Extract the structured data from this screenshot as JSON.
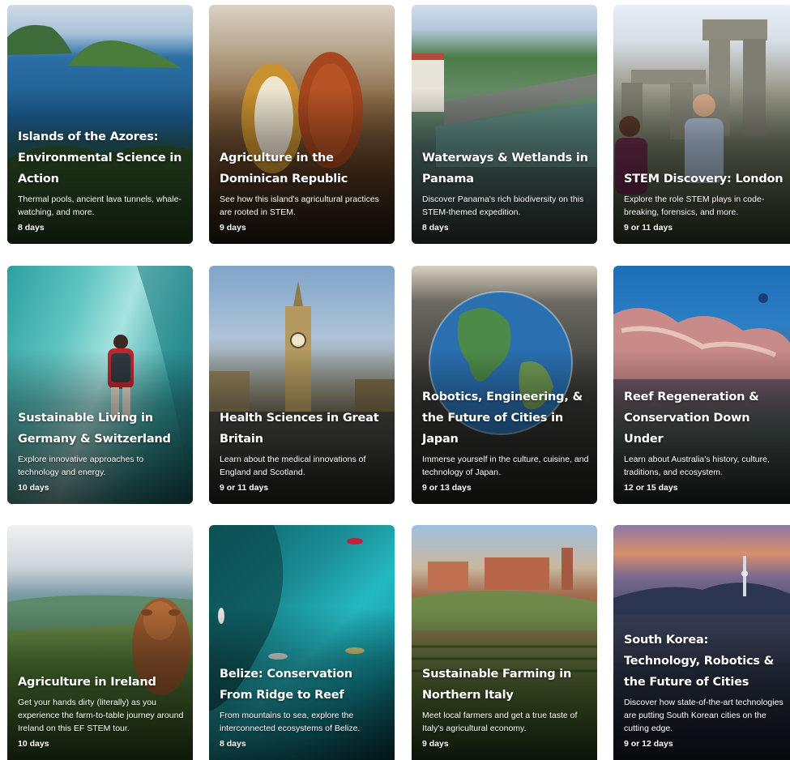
{
  "cards": [
    {
      "title": "Islands of the Azores: Environmental Science in Action",
      "desc": "Thermal pools, ancient lava tunnels, whale-watching, and more.",
      "duration": "8 days"
    },
    {
      "title": "Agriculture in the Dominican Republic",
      "desc": "See how this island's agricultural practices are rooted in STEM.",
      "duration": "9 days"
    },
    {
      "title": "Waterways & Wetlands in Panama",
      "desc": "Discover Panama's rich biodiversity on this STEM-themed expedition.",
      "duration": "8 days"
    },
    {
      "title": "STEM Discovery: London",
      "desc": "Explore the role STEM plays in code-breaking, forensics, and more.",
      "duration": "9 or 11 days"
    },
    {
      "title": "Sustainable Living in Germany & Switzerland",
      "desc": "Explore innovative approaches to technology and energy.",
      "duration": "10 days"
    },
    {
      "title": "Health Sciences in Great Britain",
      "desc": "Learn about the medical innovations of England and Scotland.",
      "duration": "9 or 11 days"
    },
    {
      "title": "Robotics, Engineering, & the Future of Cities in Japan",
      "desc": "Immerse yourself in the culture, cuisine, and technology of Japan.",
      "duration": "9 or 13 days"
    },
    {
      "title": "Reef Regeneration & Conservation Down Under",
      "desc": "Learn about Australia's history, culture, traditions, and ecosystem.",
      "duration": "12 or 15 days"
    },
    {
      "title": "Agriculture in Ireland",
      "desc": "Get your hands dirty (literally) as you experience the farm-to-table journey around Ireland on this EF STEM tour.",
      "duration": "10 days"
    },
    {
      "title": "Belize: Conservation From Ridge to Reef",
      "desc": "From mountains to sea, explore the interconnected ecosystems of Belize.",
      "duration": "8 days"
    },
    {
      "title": "Sustainable Farming in Northern Italy",
      "desc": "Meet local farmers and get a true taste of Italy's agricultural economy.",
      "duration": "9 days"
    },
    {
      "title": "South Korea: Technology, Robotics & the Future of Cities",
      "desc": "Discover how state-of-the-art technologies are putting South Korean cities on the cutting edge.",
      "duration": "9 or 12 days"
    }
  ]
}
